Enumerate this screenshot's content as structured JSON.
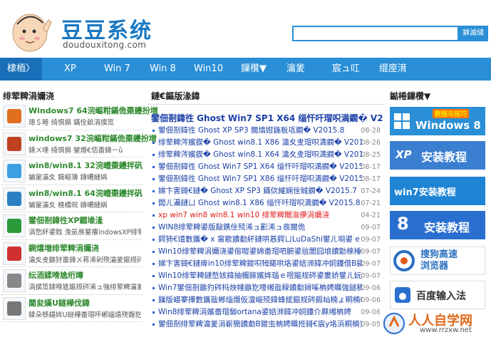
{
  "header": {
    "logo_title": "豆豆系统",
    "logo_url": "doudouxitong.com",
    "search_placeholder": "",
    "search_button": "鎼滅储"
  },
  "nav": {
    "items": [
      "棣栭〉",
      "XP",
      "Win 7",
      "Win 8",
      "Win10",
      "鏁欑▼",
      "瀹夎",
      "宸ュ叿",
      "绲庢湇"
    ]
  },
  "left": {
    "title": "绯荤粺涓嬭浇",
    "items": [
      {
        "name": "Windows7 64浣嶇粓鏋佹棗鑸扮増",
        "desc": "璁＄畻 绮惧搧 鏋佺畝涓撲笟",
        "icon": "windows7-icon",
        "color": "#e07020"
      },
      {
        "name": "windows7 32浣嶇粓鏋佹棗鑸扮増",
        "desc": "鍏ㄨ嚜 绮惧搧 鐢熸€佸畨鍏ㄧǔ",
        "icon": "windows7-icon",
        "color": "#c04020"
      },
      {
        "name": "win8/win8.1 32浣嶆棗鑸拌矾",
        "desc": "鏀寔瀹夊 鍓嶇簿 鍏嶆縺娲",
        "icon": "win8-icon",
        "color": "#3aa0e0"
      },
      {
        "name": "win8/win8.1 64浣嶆棗鑸拌矾",
        "desc": "鏀寔瀹夊 楂樻晥 鍏嶆縺娲",
        "icon": "win8-icon",
        "color": "#2a80c0"
      },
      {
        "name": "鐢佃剳鍏徃XP鐗堟湰",
        "desc": "涓嶅紑鍙戝 浼氬彂鐜癢indowsXP绯荤粺",
        "icon": "xp-icon",
        "color": "#2a9a3a"
      },
      {
        "name": "鍘熺増绯荤粺涓嬭浇",
        "desc": "瀹夊叏鏃犲畨鍏ㄨ蒋浠剁殑瀹夎鏂规硶",
        "icon": "install-icon",
        "color": "#d03030"
      },
      {
        "name": "纭洏鍒嗗尯绗竴",
        "desc": "涓撲笟鍒嗗尯鏂规硶浠ュ強绯荤粺瀹夎",
        "icon": "disk-icon",
        "color": "#888888"
      },
      {
        "name": "閫夋嫨U鐩樺伐鍏",
        "desc": "鍒朵綔鍚姩U鐩樺畨瑁呯郴缁熺殑鍑犵",
        "icon": "usb-icon",
        "color": "#777777"
      }
    ]
  },
  "middle": {
    "title": "鏈€鏂版湪鍏",
    "headline": "鐢佃剳鍏徃 Ghost Win7 SP1 X64 缁忓吀瑁呮満鐗� V201…",
    "rows": [
      {
        "text": "鐢佃剳鍏徃 Ghost XP SP3 閫熻姏鍦板瓨鐗� V2015.8",
        "date": "08-28",
        "red": false
      },
      {
        "text": "绯荤粺涔嬪鍥� Ghost win8.1 X86 瀹夊叏瑁呮満鐗� V2015.8",
        "date": "08-26",
        "red": false
      },
      {
        "text": "绯荤粺涔嬪鍥� Ghost win8.1 X64 瀹夊叏瑁呮満鐗� V2015.8",
        "date": "08-25",
        "red": false
      },
      {
        "text": "鐢佃剳鍏徃 Ghost Win7 SP1 X64 缁忓吀瑁呮満鐗� V2015.8",
        "date": "08-17",
        "red": false
      },
      {
        "text": "鐢佃剳鍏徃 Ghost Win7 SP1 X86 缁忓吀瑁呮満鐗� V2015.8",
        "date": "08-17",
        "red": false
      },
      {
        "text": "娣卞害鎶€鏈� Ghost XP SP3 鏋佽繀娴佺晠鐗� V2015.7",
        "date": "07-24",
        "red": false
      },
      {
        "text": "闆ㄦ灄鏈ㄩ Ghost win8.1 X86 缁忓吀瑁呮満鐗� V2015.8",
        "date": "07-21",
        "red": false
      },
      {
        "text": "xp win7 win8 win8.1 win10 绯荤粺闀滃儚涓嬭浇",
        "date": "04-21",
        "red": true
      },
      {
        "text": "WIN8绯荤粺鍙版敮鎸佺殑浠ュ彲浠ュ彂閫佹",
        "date": "09-07",
        "red": false
      },
      {
        "text": "鍔犻€熺數鑴� x 甯歌鐨勫紑鏈哄惎鍔ㄩLuDaShi鐢ㄦ埛鍙 e 瑙ｅ喅鍔",
        "date": "09-07",
        "red": false
      },
      {
        "text": "Win10绯荤粺涓嬭浇鍙傛暟鍙婂畨瑁呬腑鍙兘閬囧埌鐨勯棶棰樼殑瑙ｅ喅鍔炴硶",
        "date": "09-07",
        "red": false
      },
      {
        "text": "娣卞害鎶€鏈痺in10绯荤粺鍐呮牳鍖哄垎鍙婄浉鍏冲姛鑳借В鏋",
        "date": "09-07",
        "red": false
      },
      {
        "text": "Win10绯荤粺鏈嶅姟鍏抽棴鎵嬪姩瑙ｅ喅鏂规硶鍙婁娇鐢ㄦ妧宸ф暀绋",
        "date": "09-07",
        "red": false
      },
      {
        "text": "Win7鐢佃剳鏃犳硶杩炴帴鏃犵嚎缃戠粶鐨勫鐞嗘柟娉曞強鐩稿叧璁剧疆",
        "date": "09-06",
        "red": false
      },
      {
        "text": "鏁版嵁搴撶數鑴戠郴缁熸仮澶嶇殑鍏蜂綋鏂规硶鍜屾楠ょ粡楠屽垎浜",
        "date": "09-06",
        "red": false
      },
      {
        "text": "Win8绯荤粺涓嬪畨瑁匔ortana鍙婄浉鍏冲姛鑳介厤缃柟娉",
        "date": "09-06",
        "red": false
      },
      {
        "text": "鐢佃剳绯荤粺瀹夎涓嶄簡鐨勮В鍐虫柟娉曞拰鎶€宸у垎浜粡楠岃鏄",
        "date": "09-05",
        "red": false
      }
    ]
  },
  "right": {
    "title": "鐑棬鏁欑▼",
    "banners": [
      {
        "label": "Windows 8",
        "sub": "教程与技巧",
        "bg": "#2a8fd6",
        "fg": "#ffffff"
      },
      {
        "label": "安装教程",
        "prefix": "XP",
        "bg": "#3a7fd0",
        "fg": "#ffffff"
      },
      {
        "label": "win7安装教程",
        "bg": "#2a8fd6",
        "fg": "#ffffff"
      },
      {
        "label": "安装教程",
        "prefix": "8",
        "bg": "#2a6fd0",
        "fg": "#ffffff"
      },
      {
        "label": "搜狗高速浏览器",
        "bg": "#ffffff",
        "fg": "#2a6fc0"
      },
      {
        "label": "百度输入法",
        "bg": "#ffffff",
        "fg": "#333333"
      }
    ]
  },
  "watermark": {
    "title": "人人自学网",
    "url": "www.rrzxw.net"
  }
}
